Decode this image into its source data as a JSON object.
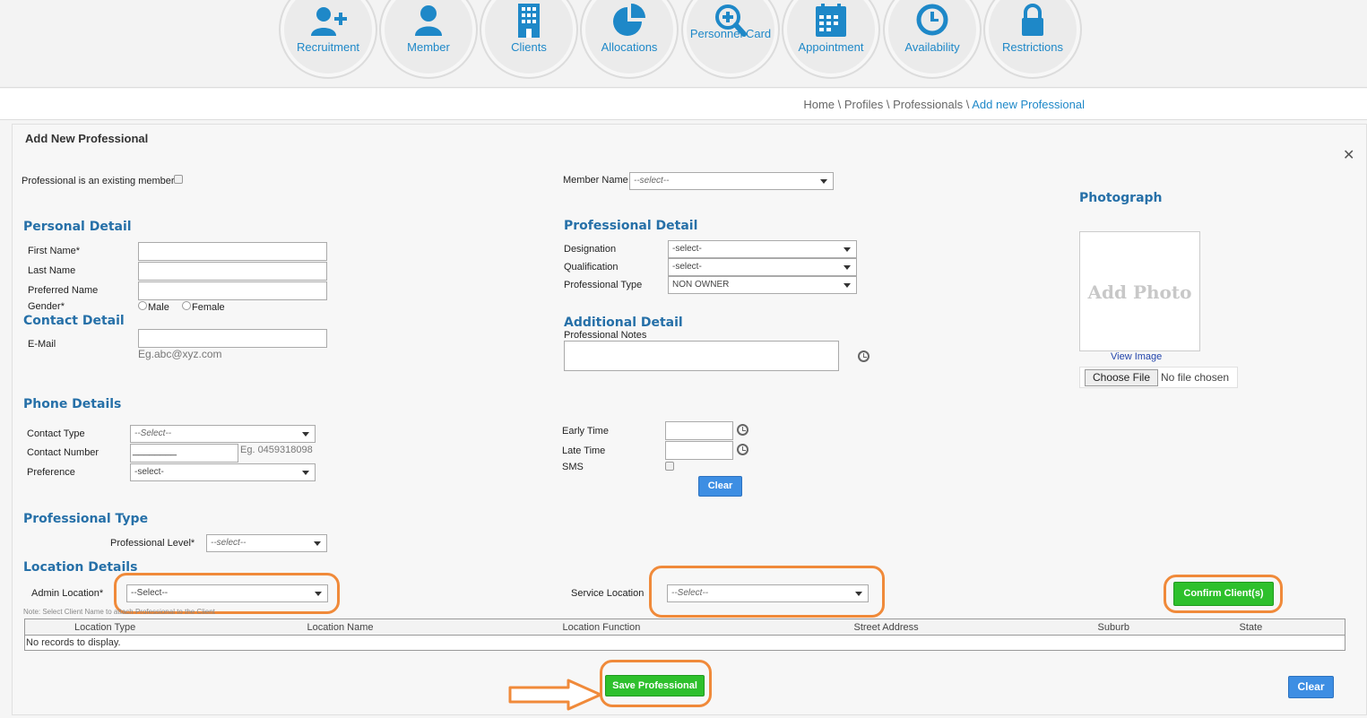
{
  "nav": [
    {
      "label": "Recruitment",
      "icon": "add-user-icon"
    },
    {
      "label": "Member",
      "icon": "user-icon"
    },
    {
      "label": "Clients",
      "icon": "building-icon"
    },
    {
      "label": "Allocations",
      "icon": "pie-chart-icon"
    },
    {
      "label": "Personnel Card",
      "icon": "search-plus-icon"
    },
    {
      "label": "Appointment",
      "icon": "calendar-icon"
    },
    {
      "label": "Availability",
      "icon": "clock-icon"
    },
    {
      "label": "Restrictions",
      "icon": "lock-icon"
    }
  ],
  "breadcrumb": {
    "home": "Home",
    "sep": " \\ ",
    "profiles": "Profiles",
    "professionals": "Professionals",
    "current": "Add new Professional"
  },
  "form": {
    "title": "Add New Professional",
    "close": "✕",
    "existing_member_label": "Professional is an existing member",
    "member_name_label": "Member Name",
    "member_name_value": "--select--",
    "photograph": {
      "heading": "Photograph",
      "placeholder": "Add Photo",
      "view_link": "View Image",
      "choose_button": "Choose File",
      "no_file": "No file chosen"
    },
    "personal": {
      "heading": "Personal Detail",
      "first_name": "First Name*",
      "last_name": "Last Name",
      "preferred_name": "Preferred Name",
      "gender": "Gender*",
      "male": "Male",
      "female": "Female"
    },
    "contact": {
      "heading": "Contact Detail",
      "email_label": "E-Mail",
      "email_hint": "Eg.abc@xyz.com"
    },
    "professional": {
      "heading": "Professional Detail",
      "designation_label": "Designation",
      "designation_value": "-select-",
      "qualification_label": "Qualification",
      "qualification_value": "-select-",
      "type_label": "Professional Type",
      "type_value": "NON OWNER"
    },
    "additional": {
      "heading": "Additional Detail",
      "notes_label": "Professional Notes"
    },
    "phone": {
      "heading": "Phone Details",
      "contact_type_label": "Contact Type",
      "contact_type_value": "--Select--",
      "contact_number_label": "Contact Number",
      "contact_number_value": "________",
      "contact_number_hint": "Eg. 0459318098",
      "preference_label": "Preference",
      "preference_value": "-select-"
    },
    "times": {
      "early_label": "Early Time",
      "late_label": "Late Time",
      "sms_label": "SMS",
      "clear_button": "Clear"
    },
    "ptype": {
      "heading": "Professional Type",
      "level_label": "Professional Level*",
      "level_value": "--select--"
    },
    "location": {
      "heading": "Location Details",
      "admin_label": "Admin Location*",
      "admin_value": "--Select--",
      "service_label": "Service Location",
      "service_value": "--Select--",
      "confirm_button": "Confirm Client(s)",
      "note": "Note: Select Client Name to attach Professional to the Client",
      "columns": [
        "Location Type",
        "Location Name",
        "Location Function",
        "Street Address",
        "Suburb",
        "State"
      ],
      "empty": "No records to display."
    },
    "save_button": "Save Professional",
    "clear_button": "Clear"
  },
  "colors": {
    "accent": "#1e88c8",
    "heading": "#2670a8",
    "highlight": "#f08a3a",
    "green": "#2ec02c",
    "blue": "#3d8ee3"
  }
}
